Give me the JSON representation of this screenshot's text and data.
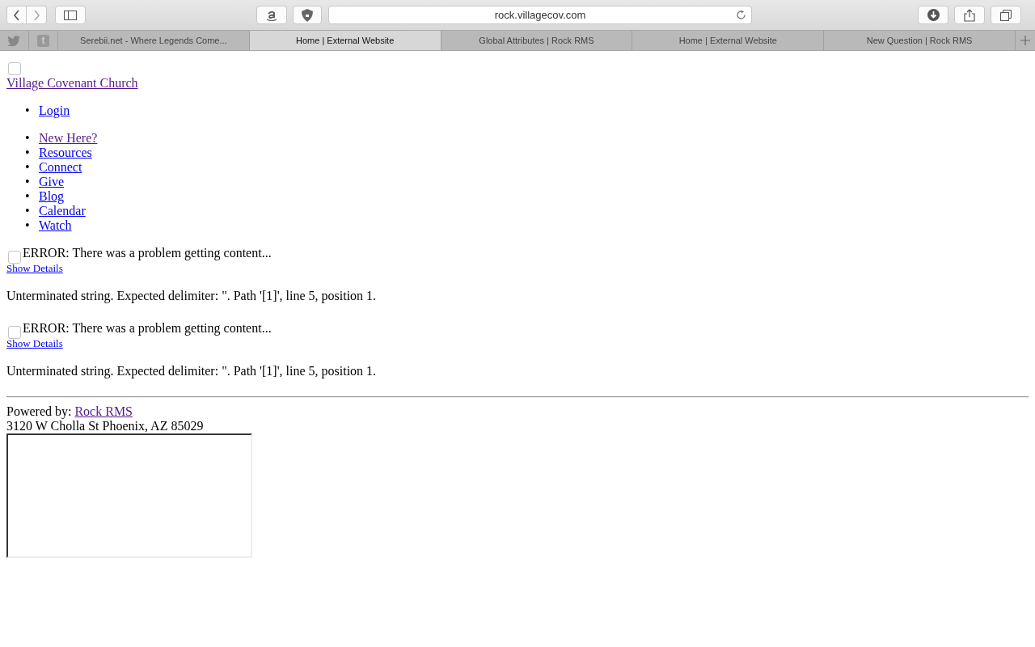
{
  "toolbar": {
    "address": "rock.villagecov.com"
  },
  "tabs": [
    {
      "kind": "bird",
      "selected": false
    },
    {
      "kind": "lettermark",
      "label": "t",
      "selected": false
    },
    {
      "kind": "page",
      "label": "Serebii.net - Where Legends Come...",
      "selected": false
    },
    {
      "kind": "page",
      "label": "Home | External Website",
      "selected": true
    },
    {
      "kind": "page",
      "label": "Global Attributes | Rock RMS",
      "selected": false
    },
    {
      "kind": "page",
      "label": "Home | External Website",
      "selected": false
    },
    {
      "kind": "page",
      "label": "New Question | Rock RMS",
      "selected": false
    }
  ],
  "page": {
    "site_title": {
      "text": "Village Covenant Church",
      "visited": true
    },
    "account_menu": [
      {
        "marker": "•",
        "label": "Login",
        "visited": false
      }
    ],
    "nav": [
      {
        "marker": "•",
        "label": "New Here?",
        "visited": true
      },
      {
        "marker": "•",
        "label": "Resources",
        "visited": false
      },
      {
        "marker": "•",
        "label": "Connect",
        "visited": false
      },
      {
        "marker": "•",
        "label": "Give",
        "visited": false
      },
      {
        "marker": "•",
        "label": "Blog",
        "visited": false
      },
      {
        "marker": "•",
        "label": "Calendar",
        "visited": false
      },
      {
        "marker": "•",
        "label": "Watch",
        "visited": false
      }
    ],
    "errors": [
      {
        "message": "ERROR: There was a problem getting content...",
        "link": "Show Details",
        "detail": "Unterminated string. Expected delimiter: \". Path '[1]', line 5, position 1."
      },
      {
        "message": "ERROR: There was a problem getting content...",
        "link": "Show Details",
        "detail": "Unterminated string. Expected delimiter: \". Path '[1]', line 5, position 1."
      }
    ],
    "footer": {
      "powered_label": "Powered by:",
      "powered_link": {
        "text": "Rock RMS",
        "visited": true
      },
      "address": "3120 W Cholla St Phoenix, AZ 85029"
    }
  }
}
